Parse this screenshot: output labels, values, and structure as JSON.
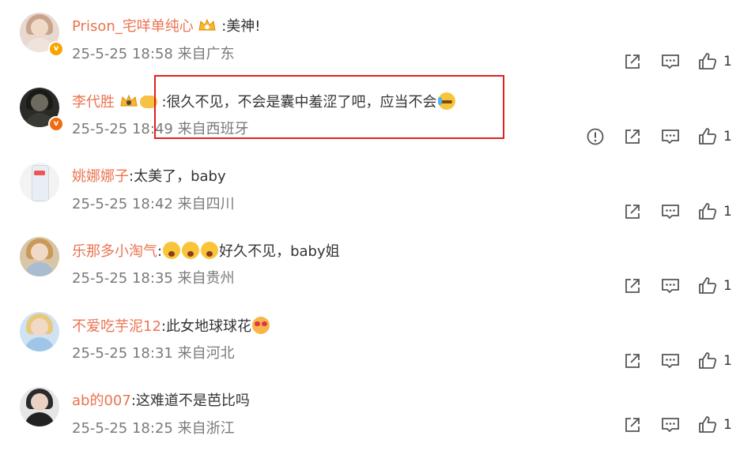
{
  "comments": [
    {
      "user": "Prison_宅咩单纯心",
      "text": ":美神!",
      "time": "25-5-25 18:58",
      "loc": "来自广东",
      "likes": "1",
      "badge": "crown",
      "emoji": ""
    },
    {
      "user": "李代胜",
      "text": ":很久不见，不会是囊中羞涩了吧，应当不会",
      "time": "25-5-25 18:49",
      "loc": "来自西班牙",
      "likes": "1",
      "badge": "crown-vip",
      "emoji": "tear"
    },
    {
      "user": "姚娜娜子",
      "text": ":太美了，baby",
      "time": "25-5-25 18:42",
      "loc": "来自四川",
      "likes": "1",
      "badge": "",
      "emoji": ""
    },
    {
      "user": "乐那多小淘气",
      "text": "好久不见，baby姐",
      "time": "25-5-25 18:35",
      "loc": "来自贵州",
      "likes": "1",
      "badge": "",
      "emoji": "shock3"
    },
    {
      "user": "不爱吃芋泥12",
      "text": ":此女地球球花",
      "time": "25-5-25 18:31",
      "loc": "来自河北",
      "likes": "1",
      "badge": "",
      "emoji": "heart-eyes"
    },
    {
      "user": "ab的007",
      "text": ":这难道不是芭比吗",
      "time": "25-5-25 18:25",
      "loc": "来自浙江",
      "likes": "1",
      "badge": "",
      "emoji": ""
    }
  ],
  "icons": {
    "share": "share-icon",
    "comment": "comment-icon",
    "like": "thumbs-up-icon",
    "report": "report-icon"
  },
  "colors": {
    "username": "#eb7350",
    "highlight": "#e02020",
    "meta": "#7a7a7a"
  }
}
